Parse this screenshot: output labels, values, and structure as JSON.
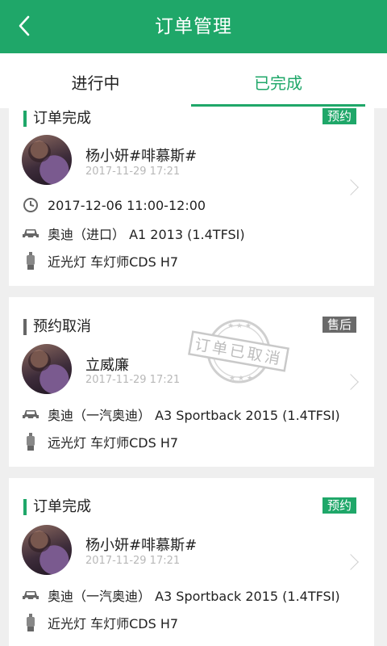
{
  "header": {
    "title": "订单管理"
  },
  "tabs": [
    {
      "label": "进行中"
    },
    {
      "label": "已完成"
    }
  ],
  "orders": [
    {
      "status": "订单完成",
      "badge": "预约",
      "name": "杨小妍#啡慕斯#",
      "date": "2017-11-29 17:21",
      "time": "2017-12-06 11:00-12:00",
      "car": "奥迪（进口） A1 2013 (1.4TFSI)",
      "product": "近光灯 车灯师CDS H7"
    },
    {
      "status": "预约取消",
      "badge": "售后",
      "name": "立威廉",
      "date": "2017-11-29 17:21",
      "car": "奥迪（一汽奥迪） A3 Sportback 2015 (1.4TFSI)",
      "product": "远光灯 车灯师CDS H7",
      "stamp": "订单已取消"
    },
    {
      "status": "订单完成",
      "badge": "预约",
      "name": "杨小妍#啡慕斯#",
      "date": "2017-11-29 17:21",
      "car": "奥迪（一汽奥迪） A3 Sportback 2015 (1.4TFSI)",
      "product": "近光灯 车灯师CDS H7"
    }
  ],
  "icons": {
    "back": "back-arrow-icon",
    "clock": "clock-icon",
    "car": "car-icon",
    "bulb": "bulb-icon",
    "chevron": "chevron-right-icon"
  },
  "colors": {
    "accent": "#1fa769",
    "gray_badge": "#6a6a6a",
    "background": "#efefef"
  }
}
